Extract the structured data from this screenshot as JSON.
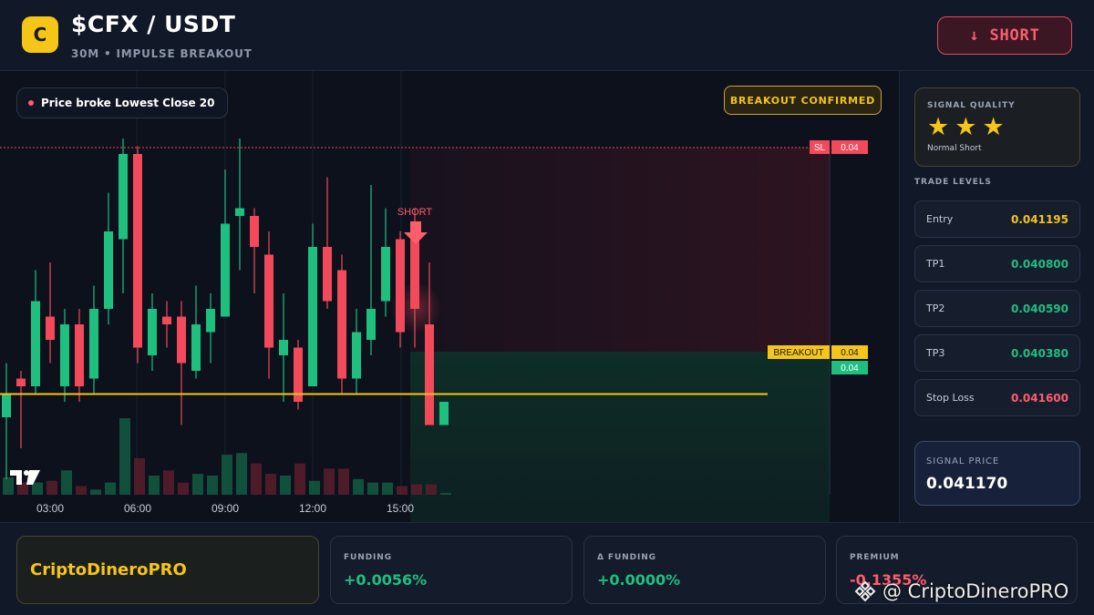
{
  "header": {
    "logo_letter": "C",
    "pair": "$CFX / USDT",
    "subtitle": "30M • IMPULSE BREAKOUT",
    "short_button": "↓ SHORT"
  },
  "chart": {
    "legend": "Price broke Lowest Close 20",
    "confirmed_badge": "BREAKOUT CONFIRMED",
    "sl_label": "SL",
    "sl_value": "0.04",
    "breakout_label": "BREAKOUT",
    "breakout_value": "0.04",
    "price_value": "0.04",
    "short_marker": "SHORT",
    "time_ticks": [
      "03:00",
      "06:00",
      "09:00",
      "12:00",
      "15:00"
    ],
    "colors": {
      "up": "#1fbf7f",
      "down": "#f2495b",
      "breakout_line": "#f5c518",
      "sl_line": "#f2495b"
    },
    "candles": [
      {
        "o": 0.04116,
        "c": 0.04119,
        "h": 0.04123,
        "l": 0.04108
      },
      {
        "o": 0.04121,
        "c": 0.0412,
        "h": 0.04122,
        "l": 0.04112
      },
      {
        "o": 0.0412,
        "c": 0.04131,
        "h": 0.04135,
        "l": 0.04119
      },
      {
        "o": 0.04129,
        "c": 0.04126,
        "h": 0.04136,
        "l": 0.04123
      },
      {
        "o": 0.0412,
        "c": 0.04128,
        "h": 0.0413,
        "l": 0.04118
      },
      {
        "o": 0.04128,
        "c": 0.0412,
        "h": 0.0413,
        "l": 0.04118
      },
      {
        "o": 0.04121,
        "c": 0.0413,
        "h": 0.04133,
        "l": 0.04119
      },
      {
        "o": 0.0413,
        "c": 0.0414,
        "h": 0.04145,
        "l": 0.04128
      },
      {
        "o": 0.04139,
        "c": 0.0415,
        "h": 0.04152,
        "l": 0.04132
      },
      {
        "o": 0.0415,
        "c": 0.04125,
        "h": 0.04151,
        "l": 0.04123
      },
      {
        "o": 0.04124,
        "c": 0.0413,
        "h": 0.04132,
        "l": 0.04122
      },
      {
        "o": 0.04129,
        "c": 0.04128,
        "h": 0.04131,
        "l": 0.04125
      },
      {
        "o": 0.04129,
        "c": 0.04123,
        "h": 0.04131,
        "l": 0.04115
      },
      {
        "o": 0.04122,
        "c": 0.04128,
        "h": 0.04133,
        "l": 0.04121
      },
      {
        "o": 0.04127,
        "c": 0.0413,
        "h": 0.04132,
        "l": 0.04123
      },
      {
        "o": 0.04129,
        "c": 0.04141,
        "h": 0.04148,
        "l": 0.04129
      },
      {
        "o": 0.04142,
        "c": 0.04143,
        "h": 0.04152,
        "l": 0.04135
      },
      {
        "o": 0.04142,
        "c": 0.04138,
        "h": 0.04143,
        "l": 0.04132
      },
      {
        "o": 0.04137,
        "c": 0.04125,
        "h": 0.0414,
        "l": 0.04121
      },
      {
        "o": 0.04124,
        "c": 0.04126,
        "h": 0.04132,
        "l": 0.04118
      },
      {
        "o": 0.04125,
        "c": 0.04118,
        "h": 0.04126,
        "l": 0.04117
      },
      {
        "o": 0.0412,
        "c": 0.04138,
        "h": 0.04141,
        "l": 0.0412
      },
      {
        "o": 0.04138,
        "c": 0.04131,
        "h": 0.04147,
        "l": 0.0413
      },
      {
        "o": 0.04135,
        "c": 0.04121,
        "h": 0.04137,
        "l": 0.04119
      },
      {
        "o": 0.04121,
        "c": 0.04127,
        "h": 0.0413,
        "l": 0.04119
      },
      {
        "o": 0.04126,
        "c": 0.0413,
        "h": 0.04146,
        "l": 0.04124
      },
      {
        "o": 0.04131,
        "c": 0.04138,
        "h": 0.04143,
        "l": 0.04129
      },
      {
        "o": 0.04139,
        "c": 0.04127,
        "h": 0.0414,
        "l": 0.04125
      },
      {
        "o": 0.04141,
        "c": 0.0413,
        "h": 0.04143,
        "l": 0.04125
      },
      {
        "o": 0.04128,
        "c": 0.04115,
        "h": 0.04136,
        "l": 0.04115
      },
      {
        "o": 0.04115,
        "c": 0.04118,
        "h": 0.04118,
        "l": 0.04115
      }
    ],
    "volumes": [
      0.5,
      0.35,
      0.35,
      0.4,
      0.7,
      0.25,
      0.15,
      0.35,
      2.2,
      1.05,
      0.55,
      0.7,
      0.35,
      0.6,
      0.55,
      1.15,
      1.2,
      0.9,
      0.6,
      0.55,
      0.9,
      0.4,
      0.75,
      0.75,
      0.45,
      0.35,
      0.35,
      0.25,
      0.3,
      0.3,
      0.05
    ],
    "ylim": [
      0.04106,
      0.0416
    ]
  },
  "sidebar": {
    "quality_label": "SIGNAL QUALITY",
    "stars": [
      "★",
      "★",
      "★"
    ],
    "quality_note": "Normal Short",
    "trade_levels_label": "TRADE LEVELS",
    "levels": [
      {
        "name": "Entry",
        "value": "0.041195",
        "color": "#f5c518"
      },
      {
        "name": "TP1",
        "value": "0.040800",
        "color": "#1fbf7f"
      },
      {
        "name": "TP2",
        "value": "0.040590",
        "color": "#1fbf7f"
      },
      {
        "name": "TP3",
        "value": "0.040380",
        "color": "#1fbf7f"
      },
      {
        "name": "Stop Loss",
        "value": "0.041600",
        "color": "#ff5d6c"
      }
    ],
    "signal_price_label": "SIGNAL PRICE",
    "signal_price": "0.041170"
  },
  "footer": {
    "brand": "CriptoDineroPRO",
    "funding_label": "FUNDING",
    "funding_value": "+0.0056%",
    "delta_funding_label": "Δ FUNDING",
    "delta_funding_value": "+0.0000%",
    "premium_label": "PREMIUM",
    "premium_value": "-0.1355%"
  },
  "watermark": "@ CriptoDineroPRO"
}
